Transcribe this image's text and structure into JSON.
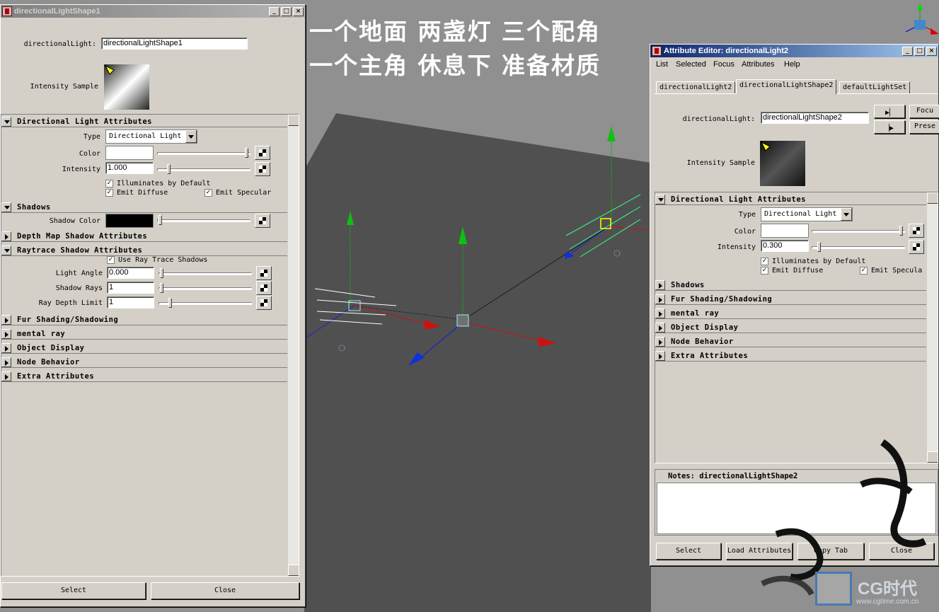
{
  "overlay": {
    "line1": "一个地面 两盏灯 三个配角",
    "line2": "一个主角 休息下 准备材质"
  },
  "left_window": {
    "title": "directionalLightShape1",
    "node_label": "directionalLight:",
    "node_value": "directionalLightShape1",
    "intensity_sample_label": "Intensity Sample",
    "sections": {
      "directional": "Directional Light Attributes",
      "shadows": "Shadows",
      "depth_map": "Depth Map Shadow Attributes",
      "raytrace": "Raytrace Shadow Attributes",
      "fur": "Fur Shading/Shadowing",
      "mental_ray": "mental ray",
      "object_display": "Object Display",
      "node_behavior": "Node Behavior",
      "extra": "Extra Attributes"
    },
    "type_label": "Type",
    "type_value": "Directional Light",
    "color_label": "Color",
    "intensity_label": "Intensity",
    "intensity_value": "1.000",
    "illuminates_label": "Illuminates by Default",
    "emit_diffuse_label": "Emit Diffuse",
    "emit_specular_label": "Emit Specular",
    "shadow_color_label": "Shadow Color",
    "use_ray_trace_label": "Use Ray Trace Shadows",
    "light_angle_label": "Light Angle",
    "light_angle_value": "0.000",
    "shadow_rays_label": "Shadow Rays",
    "shadow_rays_value": "1",
    "ray_depth_label": "Ray Depth Limit",
    "ray_depth_value": "1",
    "select_label": "Select",
    "close_label": "Close"
  },
  "right_window": {
    "title": "Attribute Editor: directionalLight2",
    "menu": [
      "List",
      "Selected",
      "Focus",
      "Attributes",
      "Help"
    ],
    "tabs": [
      "directionalLight2",
      "directionalLightShape2",
      "defaultLightSet"
    ],
    "node_label": "directionalLight:",
    "node_value": "directionalLightShape2",
    "focus_label": "Focu",
    "presets_label": "Prese",
    "intensity_sample_label": "Intensity Sample",
    "sections": {
      "directional": "Directional Light Attributes",
      "shadows": "Shadows",
      "fur": "Fur Shading/Shadowing",
      "mental_ray": "mental ray",
      "object_display": "Object Display",
      "node_behavior": "Node Behavior",
      "extra": "Extra Attributes"
    },
    "type_label": "Type",
    "type_value": "Directional Light",
    "color_label": "Color",
    "intensity_label": "Intensity",
    "intensity_value": "0.300",
    "illuminates_label": "Illuminates by Default",
    "emit_diffuse_label": "Emit Diffuse",
    "emit_specular_label": "Emit Specula",
    "notes_label": "Notes:  directionalLightShape2",
    "buttons": [
      "Select",
      "Load Attributes",
      "Copy Tab",
      "Close"
    ]
  },
  "watermark": {
    "brand": "CG时代",
    "url": "www.cgtime.com.cn"
  },
  "colors": {
    "viewport_bg": "#5a5a5a",
    "panel_bg": "#d4d0c8",
    "active_title": "#0a246a",
    "axis_x": "#cc1010",
    "axis_y": "#10b010",
    "axis_z": "#1020d0"
  }
}
